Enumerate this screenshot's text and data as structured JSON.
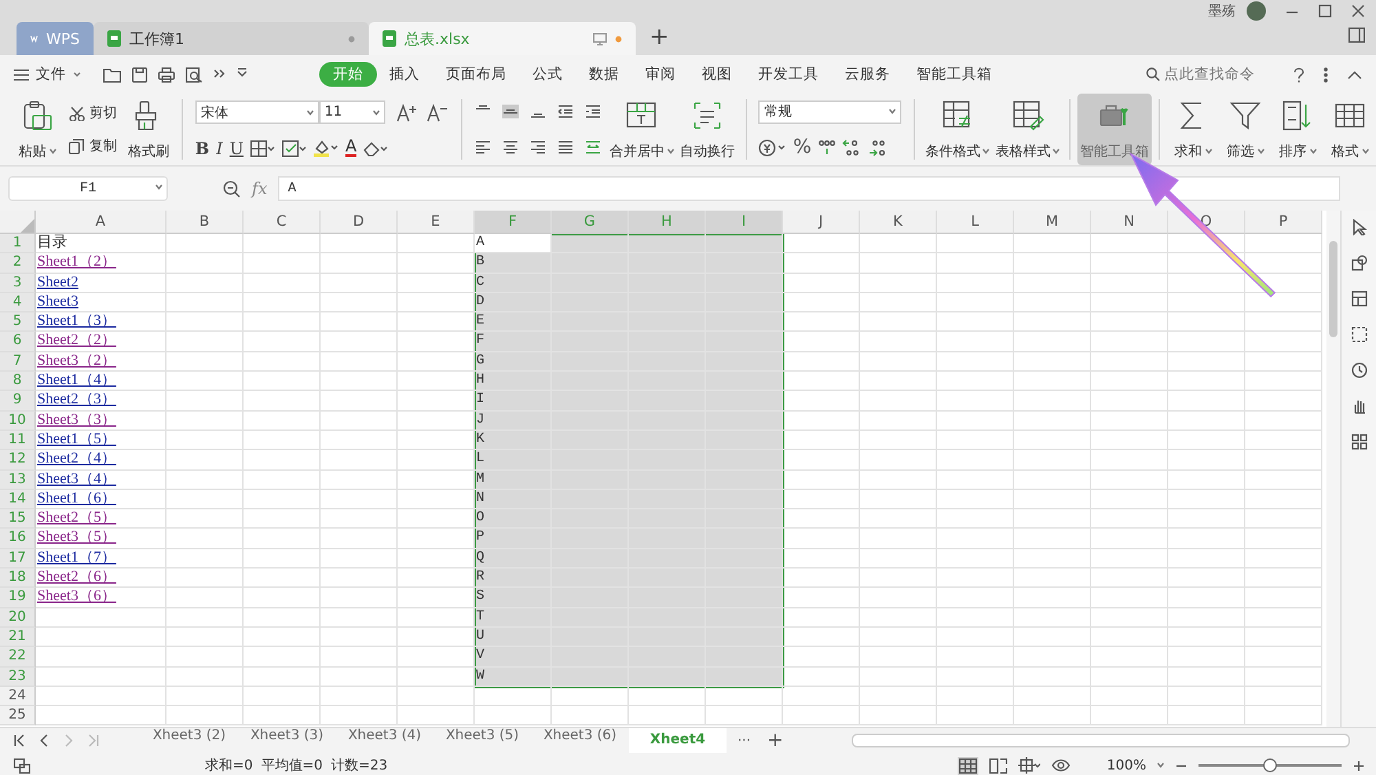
{
  "app_tabs": [
    {
      "label": "WPS",
      "kind": "home",
      "selected": false
    },
    {
      "label": "工作簿1",
      "kind": "doc",
      "selected": false
    },
    {
      "label": "总表.xlsx",
      "kind": "doc",
      "selected": true
    }
  ],
  "new_tab": "+",
  "user": {
    "name": "墨殇"
  },
  "menu": {
    "file": "文件",
    "tabs": [
      {
        "label": "开始",
        "selected": true
      },
      {
        "label": "插入",
        "selected": false
      },
      {
        "label": "页面布局",
        "selected": false
      },
      {
        "label": "公式",
        "selected": false
      },
      {
        "label": "数据",
        "selected": false
      },
      {
        "label": "审阅",
        "selected": false
      },
      {
        "label": "视图",
        "selected": false
      },
      {
        "label": "开发工具",
        "selected": false
      },
      {
        "label": "云服务",
        "selected": false
      },
      {
        "label": "智能工具箱",
        "selected": false
      }
    ],
    "search": {
      "placeholder": "点此查找命令"
    }
  },
  "ribbon": [
    {
      "kind": "large",
      "label": "粘贴",
      "menu": true,
      "selected": false
    },
    {
      "kind": "pair",
      "items": [
        "剪切",
        "复制"
      ]
    },
    {
      "kind": "large",
      "label": "格式刷",
      "menu": false,
      "selected": false,
      "separator_after": true
    },
    {
      "kind": "font",
      "font": "宋体",
      "size": "11",
      "styles": [
        "B",
        "I",
        "U"
      ],
      "font_color": "A",
      "separator_after": true
    },
    {
      "kind": "align"
    },
    {
      "kind": "large",
      "label": "合并居中",
      "menu": true,
      "selected": false
    },
    {
      "kind": "large",
      "label": "自动换行",
      "menu": false,
      "selected": false,
      "separator_after": true
    },
    {
      "kind": "number",
      "format": "常规",
      "percent": "%",
      "separator_after": true
    },
    {
      "kind": "large",
      "label": "条件格式",
      "menu": true,
      "selected": false
    },
    {
      "kind": "large",
      "label": "表格样式",
      "menu": true,
      "selected": false,
      "separator_after": true
    },
    {
      "kind": "large",
      "label": "智能工具箱",
      "menu": false,
      "selected": true,
      "separator_after": true
    },
    {
      "kind": "large",
      "label": "求和",
      "menu": true,
      "selected": false
    },
    {
      "kind": "large",
      "label": "筛选",
      "menu": true,
      "selected": false
    },
    {
      "kind": "large",
      "label": "排序",
      "menu": true,
      "selected": false
    },
    {
      "kind": "large",
      "label": "格式",
      "menu": true,
      "selected": false
    }
  ],
  "formula_bar": {
    "cell": "F1",
    "fx": "fx",
    "value": "A"
  },
  "columns": [
    {
      "label": "A",
      "selected": false
    },
    {
      "label": "B",
      "selected": false
    },
    {
      "label": "C",
      "selected": false
    },
    {
      "label": "D",
      "selected": false
    },
    {
      "label": "E",
      "selected": false
    },
    {
      "label": "F",
      "selected": true
    },
    {
      "label": "G",
      "selected": true
    },
    {
      "label": "H",
      "selected": true
    },
    {
      "label": "I",
      "selected": true
    },
    {
      "label": "J",
      "selected": false
    },
    {
      "label": "K",
      "selected": false
    },
    {
      "label": "L",
      "selected": false
    },
    {
      "label": "M",
      "selected": false
    },
    {
      "label": "N",
      "selected": false
    },
    {
      "label": "O",
      "selected": false
    },
    {
      "label": "P",
      "selected": false
    }
  ],
  "rows": [
    {
      "label": "1",
      "selected": true,
      "column_a": {
        "text": "目录",
        "kind": "text"
      },
      "column_f": {
        "text": "A",
        "active": true
      }
    },
    {
      "label": "2",
      "selected": true,
      "column_a": {
        "text": "Sheet1（2）",
        "kind": "link",
        "visited": true
      },
      "column_f": {
        "text": "B",
        "active": false
      }
    },
    {
      "label": "3",
      "selected": true,
      "column_a": {
        "text": "Sheet2",
        "kind": "link",
        "visited": false
      },
      "column_f": {
        "text": "C",
        "active": false
      }
    },
    {
      "label": "4",
      "selected": true,
      "column_a": {
        "text": "Sheet3",
        "kind": "link",
        "visited": false
      },
      "column_f": {
        "text": "D",
        "active": false
      }
    },
    {
      "label": "5",
      "selected": true,
      "column_a": {
        "text": "Sheet1（3）",
        "kind": "link",
        "visited": false
      },
      "column_f": {
        "text": "E",
        "active": false
      }
    },
    {
      "label": "6",
      "selected": true,
      "column_a": {
        "text": "Sheet2（2）",
        "kind": "link",
        "visited": true
      },
      "column_f": {
        "text": "F",
        "active": false
      }
    },
    {
      "label": "7",
      "selected": true,
      "column_a": {
        "text": "Sheet3（2）",
        "kind": "link",
        "visited": true
      },
      "column_f": {
        "text": "G",
        "active": false
      }
    },
    {
      "label": "8",
      "selected": true,
      "column_a": {
        "text": "Sheet1（4）",
        "kind": "link",
        "visited": false
      },
      "column_f": {
        "text": "H",
        "active": false
      }
    },
    {
      "label": "9",
      "selected": true,
      "column_a": {
        "text": "Sheet2（3）",
        "kind": "link",
        "visited": false
      },
      "column_f": {
        "text": "I",
        "active": false
      }
    },
    {
      "label": "10",
      "selected": true,
      "column_a": {
        "text": "Sheet3（3）",
        "kind": "link",
        "visited": true
      },
      "column_f": {
        "text": "J",
        "active": false
      }
    },
    {
      "label": "11",
      "selected": true,
      "column_a": {
        "text": "Sheet1（5）",
        "kind": "link",
        "visited": false
      },
      "column_f": {
        "text": "K",
        "active": false
      }
    },
    {
      "label": "12",
      "selected": true,
      "column_a": {
        "text": "Sheet2（4）",
        "kind": "link",
        "visited": false
      },
      "column_f": {
        "text": "L",
        "active": false
      }
    },
    {
      "label": "13",
      "selected": true,
      "column_a": {
        "text": "Sheet3（4）",
        "kind": "link",
        "visited": false
      },
      "column_f": {
        "text": "M",
        "active": false
      }
    },
    {
      "label": "14",
      "selected": true,
      "column_a": {
        "text": "Sheet1（6）",
        "kind": "link",
        "visited": false
      },
      "column_f": {
        "text": "N",
        "active": false
      }
    },
    {
      "label": "15",
      "selected": true,
      "column_a": {
        "text": "Sheet2（5）",
        "kind": "link",
        "visited": true
      },
      "column_f": {
        "text": "O",
        "active": false
      }
    },
    {
      "label": "16",
      "selected": true,
      "column_a": {
        "text": "Sheet3（5）",
        "kind": "link",
        "visited": true
      },
      "column_f": {
        "text": "P",
        "active": false
      }
    },
    {
      "label": "17",
      "selected": true,
      "column_a": {
        "text": "Sheet1（7）",
        "kind": "link",
        "visited": false
      },
      "column_f": {
        "text": "Q",
        "active": false
      }
    },
    {
      "label": "18",
      "selected": true,
      "column_a": {
        "text": "Sheet2（6）",
        "kind": "link",
        "visited": true
      },
      "column_f": {
        "text": "R",
        "active": false
      }
    },
    {
      "label": "19",
      "selected": true,
      "column_a": {
        "text": "Sheet3（6）",
        "kind": "link",
        "visited": true
      },
      "column_f": {
        "text": "S",
        "active": false
      }
    },
    {
      "label": "20",
      "selected": true,
      "column_f": {
        "text": "T",
        "active": false
      }
    },
    {
      "label": "21",
      "selected": true,
      "column_f": {
        "text": "U",
        "active": false
      }
    },
    {
      "label": "22",
      "selected": true,
      "column_f": {
        "text": "V",
        "active": false
      }
    },
    {
      "label": "23",
      "selected": true,
      "column_f": {
        "text": "W",
        "active": false
      }
    },
    {
      "label": "24",
      "selected": false
    },
    {
      "label": "25",
      "selected": false
    }
  ],
  "sheet_tabs": [
    {
      "label": "Xheet3 (2)",
      "selected": false
    },
    {
      "label": "Xheet3 (3)",
      "selected": false
    },
    {
      "label": "Xheet3 (4)",
      "selected": false
    },
    {
      "label": "Xheet3 (5)",
      "selected": false
    },
    {
      "label": "Xheet3 (6)",
      "selected": false
    },
    {
      "label": "Xheet4",
      "selected": true
    }
  ],
  "sheet_more": "···",
  "sheet_add": "+",
  "status_bar": {
    "stats": [
      "求和=0",
      "平均值=0",
      "计数=23"
    ],
    "zoom": "100%",
    "zoom_slider": {
      "level": 0.5
    }
  }
}
